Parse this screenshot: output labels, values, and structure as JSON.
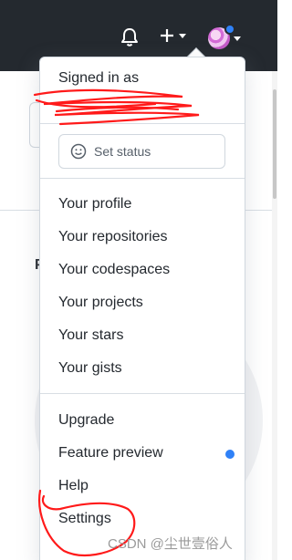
{
  "menu": {
    "signed_in_label": "Signed in as",
    "set_status_label": "Set status",
    "items": [
      "Your profile",
      "Your repositories",
      "Your codespaces",
      "Your projects",
      "Your stars",
      "Your gists",
      "Upgrade",
      "Feature preview",
      "Help",
      "Settings"
    ]
  },
  "background": {
    "letter": "P"
  },
  "watermark": "CSDN @尘世壹俗人",
  "colors": {
    "header_bg": "#24292f",
    "accent_dot": "#2f81f7",
    "scribble": "#ff0000"
  },
  "icons": [
    "bell-icon",
    "plus-icon",
    "avatar",
    "smiley-icon"
  ]
}
